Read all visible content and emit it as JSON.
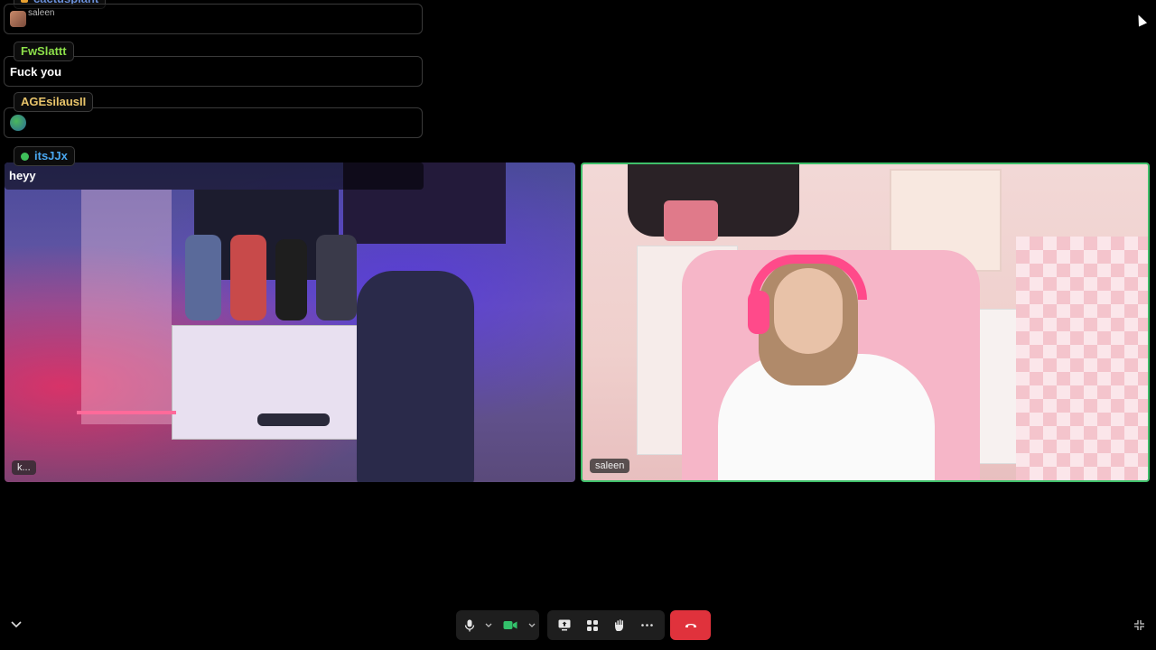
{
  "chat": {
    "messages": [
      {
        "user": "cactusplant",
        "text": "saleen",
        "name_color": "#6a8fd8"
      },
      {
        "user": "FwSlattt",
        "text": "Fuck you",
        "name_color": "#8de04a"
      },
      {
        "user": "AGEsilausII",
        "text": "",
        "name_color": "#e8c46a"
      },
      {
        "user": "itsJJx",
        "text": "heyy",
        "name_color": "#4aa7f0"
      }
    ]
  },
  "video": {
    "tiles": [
      {
        "label": "k..."
      },
      {
        "label": "saleen",
        "active_border": "#3fbf6a"
      }
    ]
  },
  "controls": {
    "microphone": {
      "icon": "microphone-icon"
    },
    "camera": {
      "icon": "camera-icon",
      "active_color": "#33c16b"
    },
    "share_screen": {
      "icon": "share-screen-icon"
    },
    "layout": {
      "icon": "grid-icon"
    },
    "reactions": {
      "icon": "hand-icon"
    },
    "more": {
      "icon": "more-icon"
    },
    "hang_up": {
      "icon": "hang-up-icon",
      "color": "#e0323c"
    },
    "collapse": {
      "icon": "chevron-down-icon"
    },
    "minimize": {
      "icon": "minimize-icon"
    }
  }
}
